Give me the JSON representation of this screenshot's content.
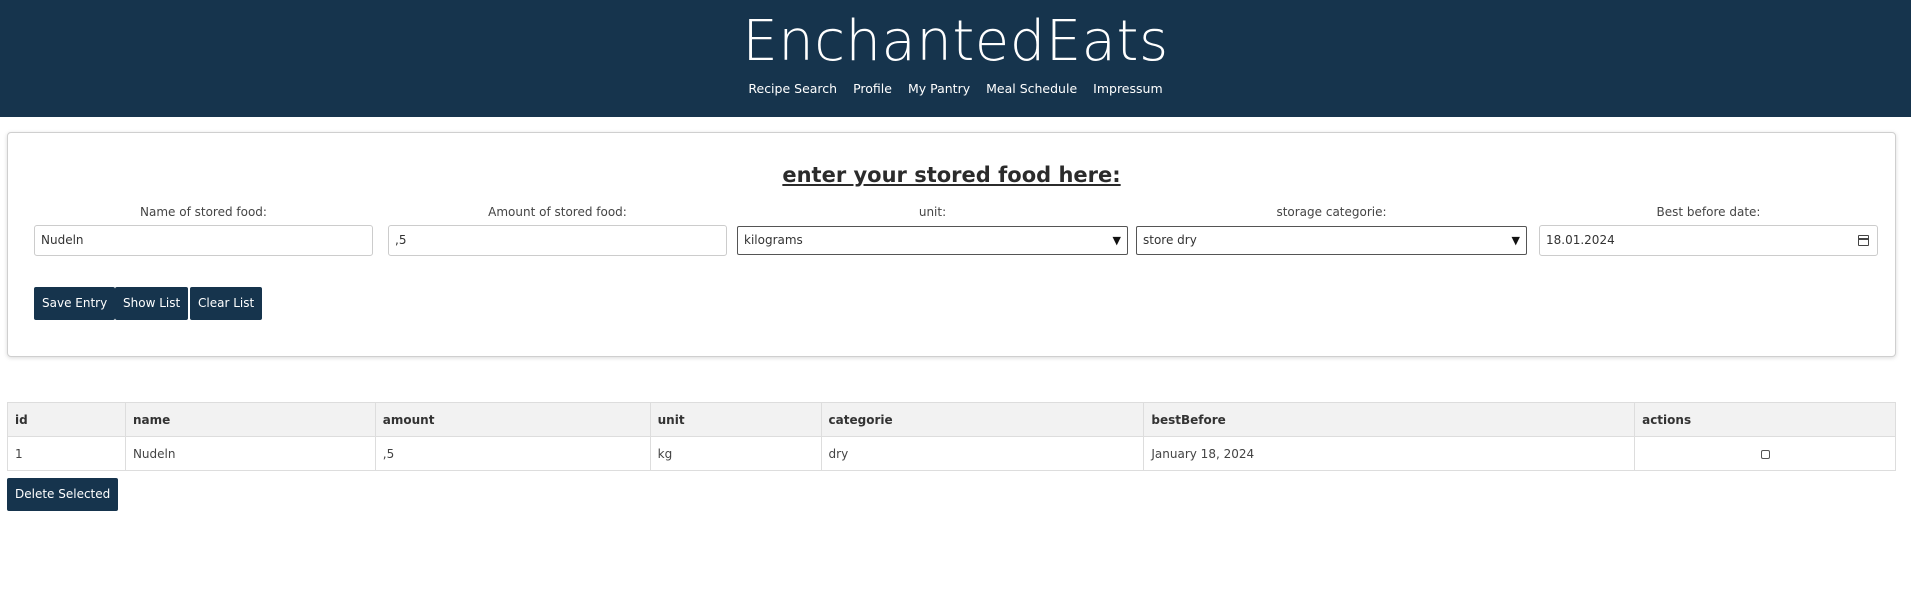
{
  "header": {
    "brand": "EnchantedEats",
    "nav": [
      "Recipe Search",
      "Profile",
      "My Pantry",
      "Meal Schedule",
      "Impressum"
    ]
  },
  "form": {
    "title": "enter your stored food here:",
    "name_label": "Name of stored food:",
    "name_value": "Nudeln",
    "amount_label": "Amount of stored food:",
    "amount_value": ",5",
    "unit_label": "unit:",
    "unit_value": "kilograms",
    "category_label": "storage categorie:",
    "category_value": "store dry",
    "date_label": "Best before date:",
    "date_value": "18.01.2024",
    "buttons": {
      "save": "Save Entry",
      "show": "Show List",
      "clear": "Clear List"
    }
  },
  "table": {
    "headers": [
      "id",
      "name",
      "amount",
      "unit",
      "categorie",
      "bestBefore",
      "actions"
    ],
    "rows": [
      [
        "1",
        "Nudeln",
        ",5",
        "kg",
        "dry",
        "January 18, 2024"
      ]
    ]
  },
  "delete_button": "Delete Selected",
  "colors": {
    "primary": "#16344d",
    "table_header_bg": "#f2f2f2"
  },
  "icons": {
    "select_arrow": "chevron-down-icon",
    "date_picker": "calendar-icon"
  }
}
